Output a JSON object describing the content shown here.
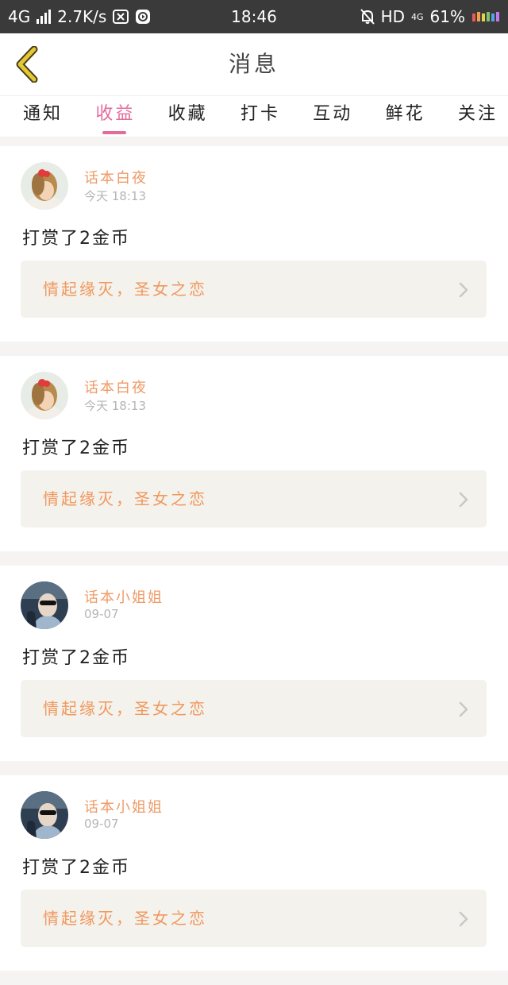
{
  "status_bar": {
    "network_left": "4G",
    "speed": "2.7K/s",
    "time": "18:46",
    "hd": "HD",
    "network_right": "4G",
    "battery": "61%"
  },
  "header": {
    "title": "消息"
  },
  "tabs": [
    {
      "label": "通知"
    },
    {
      "label": "收益",
      "active": true
    },
    {
      "label": "收藏"
    },
    {
      "label": "打卡"
    },
    {
      "label": "互动"
    },
    {
      "label": "鲜花"
    },
    {
      "label": "关注"
    }
  ],
  "messages": [
    {
      "user": "话本白夜",
      "time": "今天 18:13",
      "text": "打赏了2金币",
      "book": "情起缘灭，圣女之恋",
      "avatar": "girl-avatar"
    },
    {
      "user": "话本白夜",
      "time": "今天 18:13",
      "text": "打赏了2金币",
      "book": "情起缘灭，圣女之恋",
      "avatar": "girl-avatar"
    },
    {
      "user": "话本小姐姐",
      "time": "09-07",
      "text": "打赏了2金币",
      "book": "情起缘灭，圣女之恋",
      "avatar": "man-sunglasses-avatar"
    },
    {
      "user": "话本小姐姐",
      "time": "09-07",
      "text": "打赏了2金币",
      "book": "情起缘灭，圣女之恋",
      "avatar": "man-sunglasses-avatar"
    }
  ],
  "colors": {
    "accent_pink": "#e46b9b",
    "accent_orange": "#f0985f",
    "back_icon": "#e2c934"
  }
}
